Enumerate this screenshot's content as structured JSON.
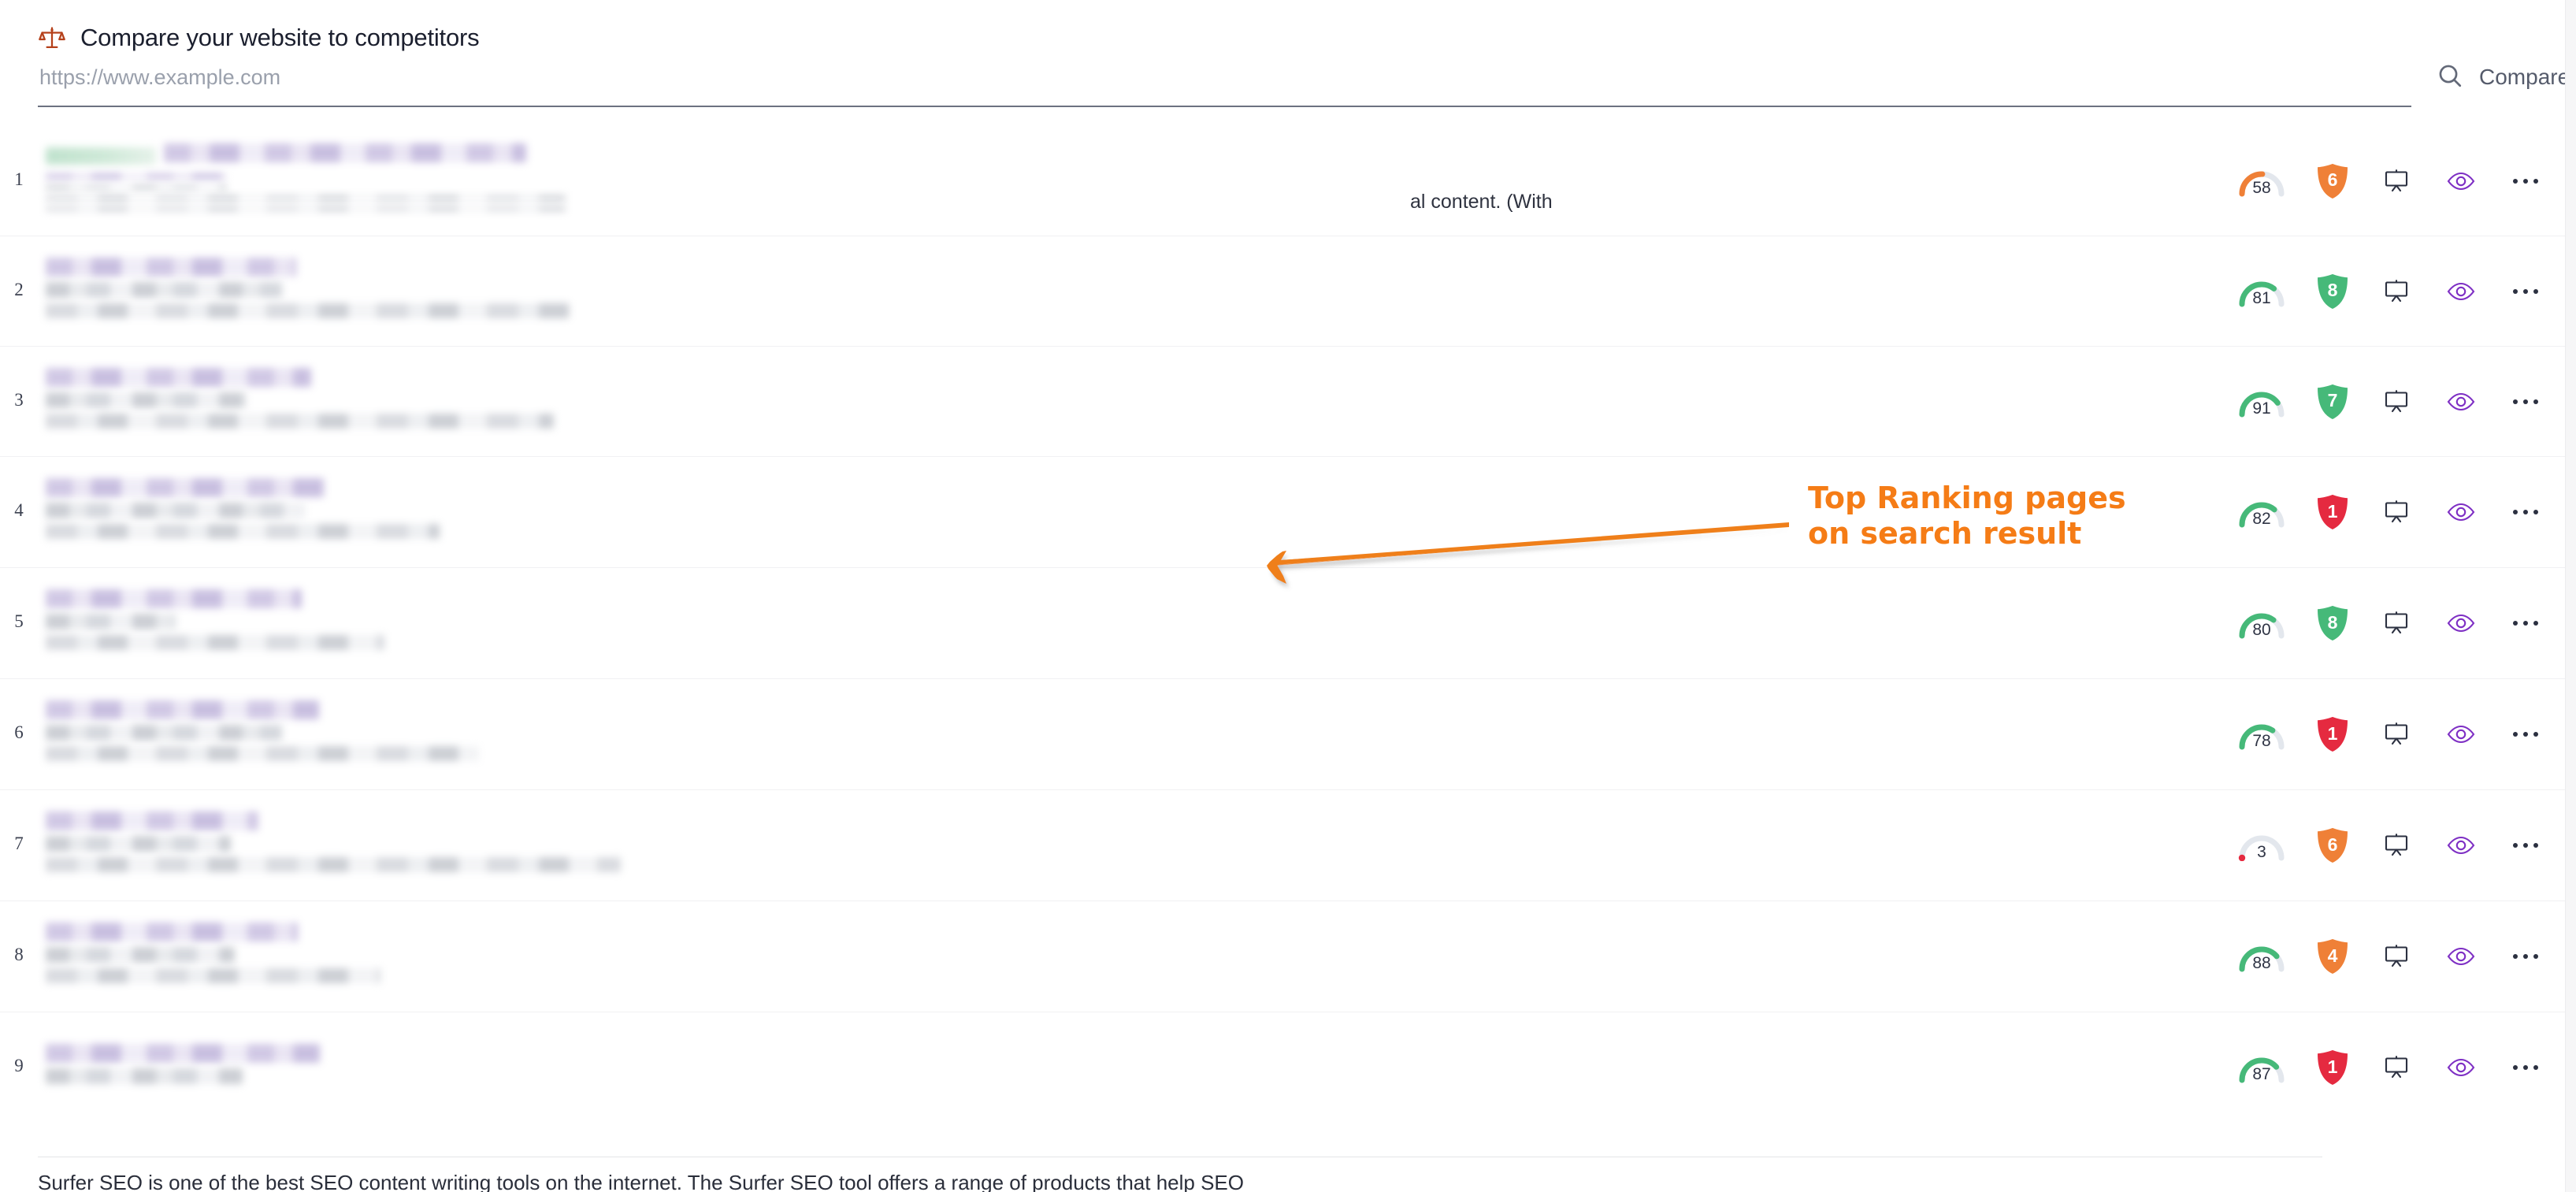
{
  "header": {
    "icon": "scales-balance-icon",
    "title": "Compare your website to competitors"
  },
  "search": {
    "value": "",
    "placeholder": "https://www.example.com",
    "compare_label": "Compare",
    "search_icon": "search-icon"
  },
  "icons": {
    "presentation": "presentation-board-icon",
    "eye": "eye-icon",
    "more": "more-options-icon"
  },
  "colors": {
    "green": "#46b979",
    "orange": "#ef8037",
    "red": "#e52a40",
    "purple": "#7e2fc4",
    "gauge_track": "#e3e7ed",
    "annotation": "#f57c16",
    "text_dark": "#2b3040"
  },
  "results": [
    {
      "rank": "1",
      "score": "58",
      "score_color": "#ef8037",
      "badge": "6",
      "badge_color": "#ef8037",
      "visible_text": "al content. (With",
      "lines": [
        "tag-title",
        "url",
        "desc",
        "desc"
      ]
    },
    {
      "rank": "2",
      "score": "81",
      "score_color": "#46b979",
      "badge": "8",
      "badge_color": "#46b979",
      "visible_text": "",
      "lines": [
        "title",
        "url",
        "desc"
      ]
    },
    {
      "rank": "3",
      "score": "91",
      "score_color": "#46b979",
      "badge": "7",
      "badge_color": "#46b979",
      "visible_text": "",
      "lines": [
        "title",
        "url",
        "desc"
      ]
    },
    {
      "rank": "4",
      "score": "82",
      "score_color": "#46b979",
      "badge": "1",
      "badge_color": "#e52a40",
      "visible_text": "",
      "lines": [
        "title",
        "url",
        "desc"
      ]
    },
    {
      "rank": "5",
      "score": "80",
      "score_color": "#46b979",
      "badge": "8",
      "badge_color": "#46b979",
      "visible_text": "",
      "lines": [
        "title",
        "url",
        "desc"
      ]
    },
    {
      "rank": "6",
      "score": "78",
      "score_color": "#46b979",
      "badge": "1",
      "badge_color": "#e52a40",
      "visible_text": "",
      "lines": [
        "title",
        "url",
        "desc"
      ]
    },
    {
      "rank": "7",
      "score": "3",
      "score_color": "#e52a40",
      "badge": "6",
      "badge_color": "#ef8037",
      "visible_text": "",
      "lines": [
        "title",
        "url",
        "desc"
      ]
    },
    {
      "rank": "8",
      "score": "88",
      "score_color": "#46b979",
      "badge": "4",
      "badge_color": "#ef8037",
      "visible_text": "",
      "lines": [
        "title",
        "url",
        "desc"
      ]
    },
    {
      "rank": "9",
      "score": "87",
      "score_color": "#46b979",
      "badge": "1",
      "badge_color": "#e52a40",
      "visible_text": "",
      "lines": [
        "title",
        "url"
      ]
    }
  ],
  "annotation": {
    "line1": "Top Ranking pages",
    "line2": "on search result",
    "arrow": "left-pointing-arrow"
  },
  "footer": {
    "text": "Surfer SEO is one of the best SEO content writing tools on the internet. The Surfer SEO tool offers a range of products that help SEO"
  }
}
